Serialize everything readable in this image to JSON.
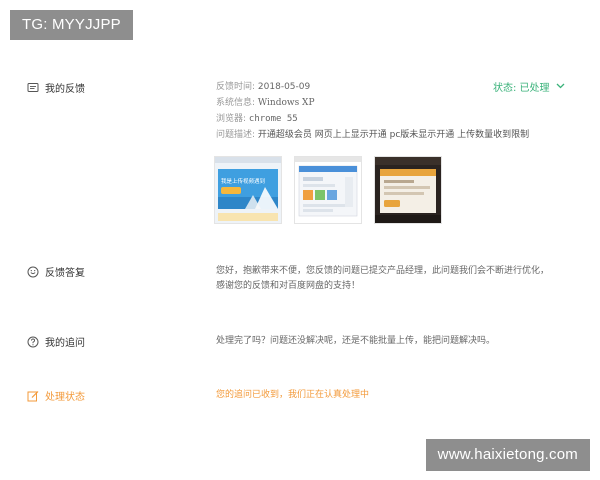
{
  "watermarks": {
    "top": "TG: MYYJJPP",
    "bottom": "www.haixietong.com"
  },
  "feedback": {
    "label": "我的反馈",
    "time_label": "反馈时间:",
    "time_value": "2018-05-09",
    "os_label": "系统信息:",
    "os_value": "Windows XP",
    "browser_label": "浏览器:",
    "browser_value": "chrome 55",
    "desc_label": "问题描述:",
    "desc_value": "开通超级会员 网页上上显示开通 pc版未显示开通 上传数量收到限制",
    "status_label": "状态: 已处理",
    "screenshot_text": "我是上传视频遇到"
  },
  "reply": {
    "label": "反馈答复",
    "line1": "您好，抱歉带来不便，您反馈的问题已提交产品经理，此问题我们会不断进行优化，",
    "line2": "感谢您的反馈和对百度网盘的支持！"
  },
  "followup": {
    "label": "我的追问",
    "text": "处理完了吗？问题还没解决呢，还是不能批量上传，能把问题解决吗。"
  },
  "processing": {
    "label": "处理状态",
    "text": "您的追问已收到，我们正在认真处理中"
  },
  "colors": {
    "accent_green": "#3ab27a",
    "accent_orange": "#f39a3a"
  }
}
